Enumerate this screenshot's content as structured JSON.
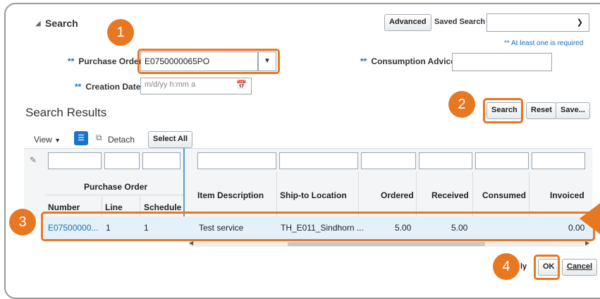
{
  "search": {
    "title": "Search",
    "advanced_label": "Advanced",
    "saved_search_label": "Saved Search",
    "required_note": "** At least one is required",
    "po_label": "Purchase Order",
    "po_value": "E0750000065PO",
    "consumption_label": "Consumption Advice",
    "creation_label": "Creation Date",
    "creation_placeholder": "m/d/yy h:mm a",
    "req_mark": "**"
  },
  "actions": {
    "search": "Search",
    "reset": "Reset",
    "save": "Save..."
  },
  "results": {
    "title": "Search Results",
    "view_label": "View",
    "detach_label": "Detach",
    "select_all_label": "Select All",
    "group_header": "Purchase Order",
    "columns": [
      "Number",
      "Line",
      "Schedule",
      "Item Description",
      "Ship-to Location",
      "Ordered",
      "Received",
      "Consumed",
      "Invoiced"
    ],
    "row": {
      "number": "E07500000...",
      "line": "1",
      "schedule": "1",
      "item": "Test service",
      "ship_to": "TH_E011_Sindhorn ...",
      "ordered": "5.00",
      "received": "5.00",
      "consumed": "",
      "invoiced": "0.00"
    }
  },
  "footer": {
    "apply_partial": "ly",
    "ok": "OK",
    "cancel": "Cancel"
  },
  "callouts": [
    "1",
    "2",
    "3",
    "4"
  ],
  "colors": {
    "accent": "#e87722",
    "link": "#1a6fb5"
  },
  "icons": [
    "collapse-triangle-icon",
    "chevron-down-icon",
    "calendar-icon",
    "query-by-example-icon",
    "detach-icon",
    "pencil-icon"
  ]
}
